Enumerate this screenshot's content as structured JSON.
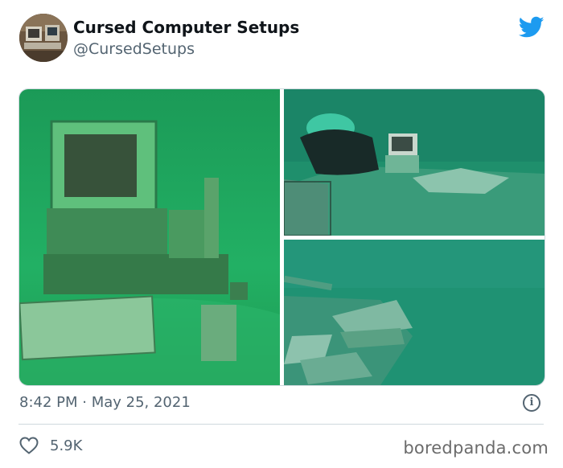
{
  "author": {
    "display_name": "Cursed Computer Setups",
    "handle": "@CursedSetups",
    "avatar_icon": "avatar-photo"
  },
  "brand": {
    "icon": "twitter-bird-icon",
    "color": "#1d9bf0"
  },
  "media": {
    "photos": [
      {
        "icon": "underwater-computer-photo"
      },
      {
        "icon": "scuba-diver-photo"
      },
      {
        "icon": "underwater-wreck-photo"
      }
    ]
  },
  "meta": {
    "timestamp": "8:42 PM · May 25, 2021",
    "info_icon": "info-icon"
  },
  "actions": {
    "likes": "5.9K",
    "like_icon": "heart-icon"
  },
  "watermark": {
    "text": "boredpanda.com"
  }
}
